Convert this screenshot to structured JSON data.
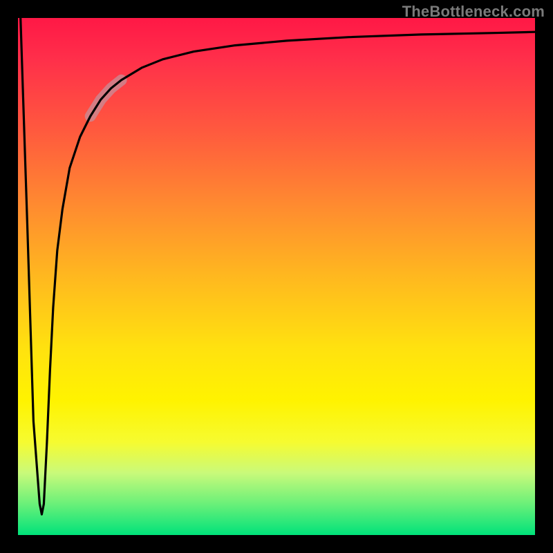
{
  "attribution": "TheBottleneck.com",
  "colors": {
    "page_bg": "#000000",
    "attribution_text": "#7a7a7a",
    "curve": "#000000",
    "highlight": "rgba(200,140,150,0.78)",
    "gradient_stops": [
      "#ff1846",
      "#ff2f4a",
      "#ff5a3e",
      "#ff8a30",
      "#ffb81f",
      "#ffe20f",
      "#fff300",
      "#f6fb30",
      "#c9fa7a",
      "#6af079",
      "#00e27a"
    ]
  },
  "chart_data": {
    "type": "line",
    "title": "",
    "xlabel": "",
    "ylabel": "",
    "xlim": [
      0,
      100
    ],
    "ylim": [
      0,
      100
    ],
    "grid": false,
    "annotations": [],
    "series": [
      {
        "name": "curve",
        "x": [
          0.5,
          1.8,
          3.0,
          4.2,
          4.6,
          5.0,
          5.6,
          6.2,
          6.8,
          7.6,
          8.6,
          10.0,
          12.0,
          14.0,
          16.0,
          18.0,
          20.0,
          24.0,
          28.0,
          34.0,
          42.0,
          52.0,
          64.0,
          78.0,
          92.0,
          100.0
        ],
        "y": [
          100.0,
          60.0,
          22.0,
          6.0,
          4.0,
          6.0,
          18.0,
          32.0,
          44.0,
          55.0,
          63.0,
          71.0,
          77.0,
          81.0,
          84.2,
          86.4,
          88.0,
          90.4,
          92.0,
          93.5,
          94.7,
          95.6,
          96.3,
          96.8,
          97.1,
          97.3
        ]
      }
    ],
    "highlight_range": {
      "x_start": 14.0,
      "x_end": 20.0
    }
  }
}
